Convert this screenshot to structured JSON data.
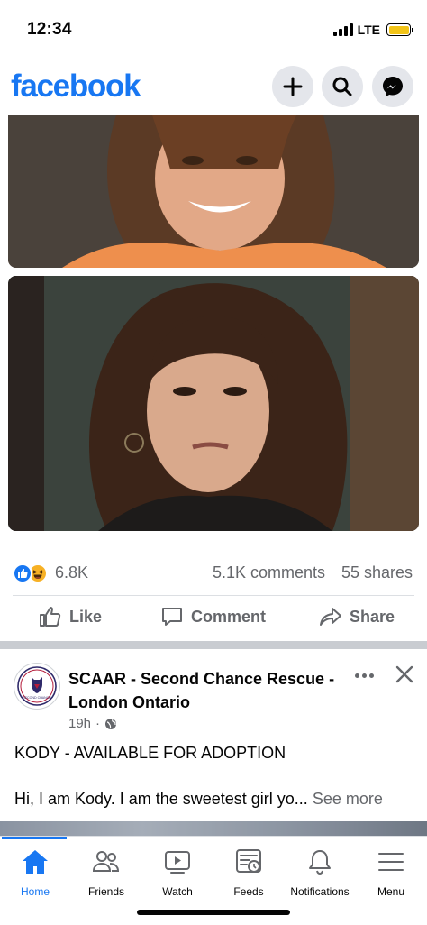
{
  "status_bar": {
    "time": "12:34",
    "network": "LTE",
    "battery_color": "#f2c417"
  },
  "header": {
    "logo": "facebook",
    "brand_color": "#1877f2",
    "buttons": [
      "plus-icon",
      "search-icon",
      "messenger-icon"
    ]
  },
  "post1": {
    "photos": [
      "woman-smiling-photo",
      "woman-serious-photo"
    ],
    "reactions": {
      "types": [
        "like",
        "haha"
      ],
      "count": "6.8K"
    },
    "comments": "5.1K comments",
    "shares": "55 shares",
    "actions": {
      "like": "Like",
      "comment": "Comment",
      "share": "Share"
    }
  },
  "post2": {
    "author": "SCAAR - Second Chance Rescue - London Ontario",
    "avatar_text": "SECOND CHANCE",
    "time": "19h",
    "headline": "KODY - AVAILABLE FOR ADOPTION",
    "body": "Hi, I am Kody. I am the sweetest girl yo...",
    "see_more": "See more"
  },
  "bottom_nav": {
    "items": [
      {
        "label": "Home",
        "icon": "home-icon",
        "active": true
      },
      {
        "label": "Friends",
        "icon": "friends-icon",
        "active": false
      },
      {
        "label": "Watch",
        "icon": "watch-icon",
        "active": false
      },
      {
        "label": "Feeds",
        "icon": "feeds-icon",
        "active": false
      },
      {
        "label": "Notifications",
        "icon": "bell-icon",
        "active": false
      },
      {
        "label": "Menu",
        "icon": "menu-icon",
        "active": false
      }
    ]
  }
}
